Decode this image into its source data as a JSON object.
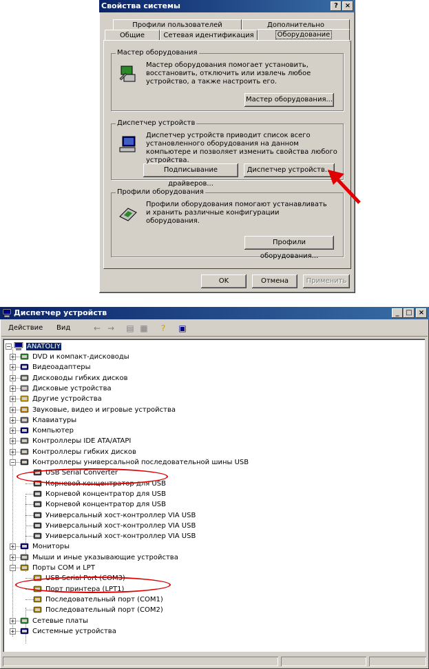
{
  "sysprops": {
    "title": "Свойства системы",
    "help_btn": "?",
    "close_btn": "×",
    "tabs_row1": [
      "Профили пользователей",
      "Дополнительно"
    ],
    "tabs_row2": [
      "Общие",
      "Сетевая идентификация",
      "Оборудование"
    ],
    "hw_wizard": {
      "title": "Мастер оборудования",
      "text": "Мастер оборудования помогает установить, восстановить, отключить или извлечь любое устройство, а также настроить его.",
      "button": "Мастер оборудования..."
    },
    "dev_manager": {
      "title": "Диспетчер устройств",
      "text": "Диспетчер устройств приводит список всего установленного оборудования на данном компьютере и позволяет изменить свойства любого устройства.",
      "sign_button": "Подписывание драйверов...",
      "dm_button": "Диспетчер устройств..."
    },
    "hw_profiles": {
      "title": "Профили оборудования",
      "text": "Профили оборудования помогают устанавливать и хранить различные конфигурации оборудования.",
      "button": "Профили оборудования..."
    },
    "ok": "OK",
    "cancel": "Отмена",
    "apply": "Применить"
  },
  "devmgr": {
    "title": "Диспетчер устройств",
    "menu": [
      "Действие",
      "Вид"
    ],
    "toolbar_icons": [
      "back-icon",
      "forward-icon",
      "properties-icon",
      "view-icon",
      "help-icon",
      "scan-icon"
    ],
    "root": "ANATOLIY",
    "tree": [
      {
        "label": "DVD и компакт-дисководы",
        "icon": "dvd-icon"
      },
      {
        "label": "Видеоадаптеры",
        "icon": "display-adapter-icon"
      },
      {
        "label": "Дисководы гибких дисков",
        "icon": "floppy-icon"
      },
      {
        "label": "Дисковые устройства",
        "icon": "disk-icon"
      },
      {
        "label": "Другие устройства",
        "icon": "unknown-device-icon"
      },
      {
        "label": "Звуковые, видео и игровые устройства",
        "icon": "sound-icon"
      },
      {
        "label": "Клавиатуры",
        "icon": "keyboard-icon"
      },
      {
        "label": "Компьютер",
        "icon": "computer-icon"
      },
      {
        "label": "Контроллеры IDE ATA/ATAPI",
        "icon": "ide-icon"
      },
      {
        "label": "Контроллеры гибких дисков",
        "icon": "floppy-controller-icon"
      },
      {
        "label": "Контроллеры универсальной последовательной шины USB",
        "icon": "usb-icon"
      },
      {
        "label": "USB Serial Converter",
        "icon": "usb-icon"
      },
      {
        "label": "Корневой концентратор для USB",
        "icon": "usb-icon"
      },
      {
        "label": "Корневой концентратор для USB",
        "icon": "usb-icon"
      },
      {
        "label": "Корневой концентратор для USB",
        "icon": "usb-icon"
      },
      {
        "label": "Универсальный хост-контроллер VIA USB",
        "icon": "usb-icon"
      },
      {
        "label": "Универсальный хост-контроллер VIA USB",
        "icon": "usb-icon"
      },
      {
        "label": "Универсальный хост-контроллер VIA USB",
        "icon": "usb-icon"
      },
      {
        "label": "Мониторы",
        "icon": "monitor-icon"
      },
      {
        "label": "Мыши и иные указывающие устройства",
        "icon": "mouse-icon"
      },
      {
        "label": "Порты COM и LPT",
        "icon": "port-icon"
      },
      {
        "label": "USB Serial Port (COM3)",
        "icon": "port-icon"
      },
      {
        "label": "Порт принтера (LPT1)",
        "icon": "port-icon"
      },
      {
        "label": "Последовательный порт (COM1)",
        "icon": "port-icon"
      },
      {
        "label": "Последовательный порт (COM2)",
        "icon": "port-icon"
      },
      {
        "label": "Сетевые платы",
        "icon": "network-icon"
      },
      {
        "label": "Системные устройства",
        "icon": "system-icon"
      }
    ]
  },
  "annotation_color": "#e00000"
}
